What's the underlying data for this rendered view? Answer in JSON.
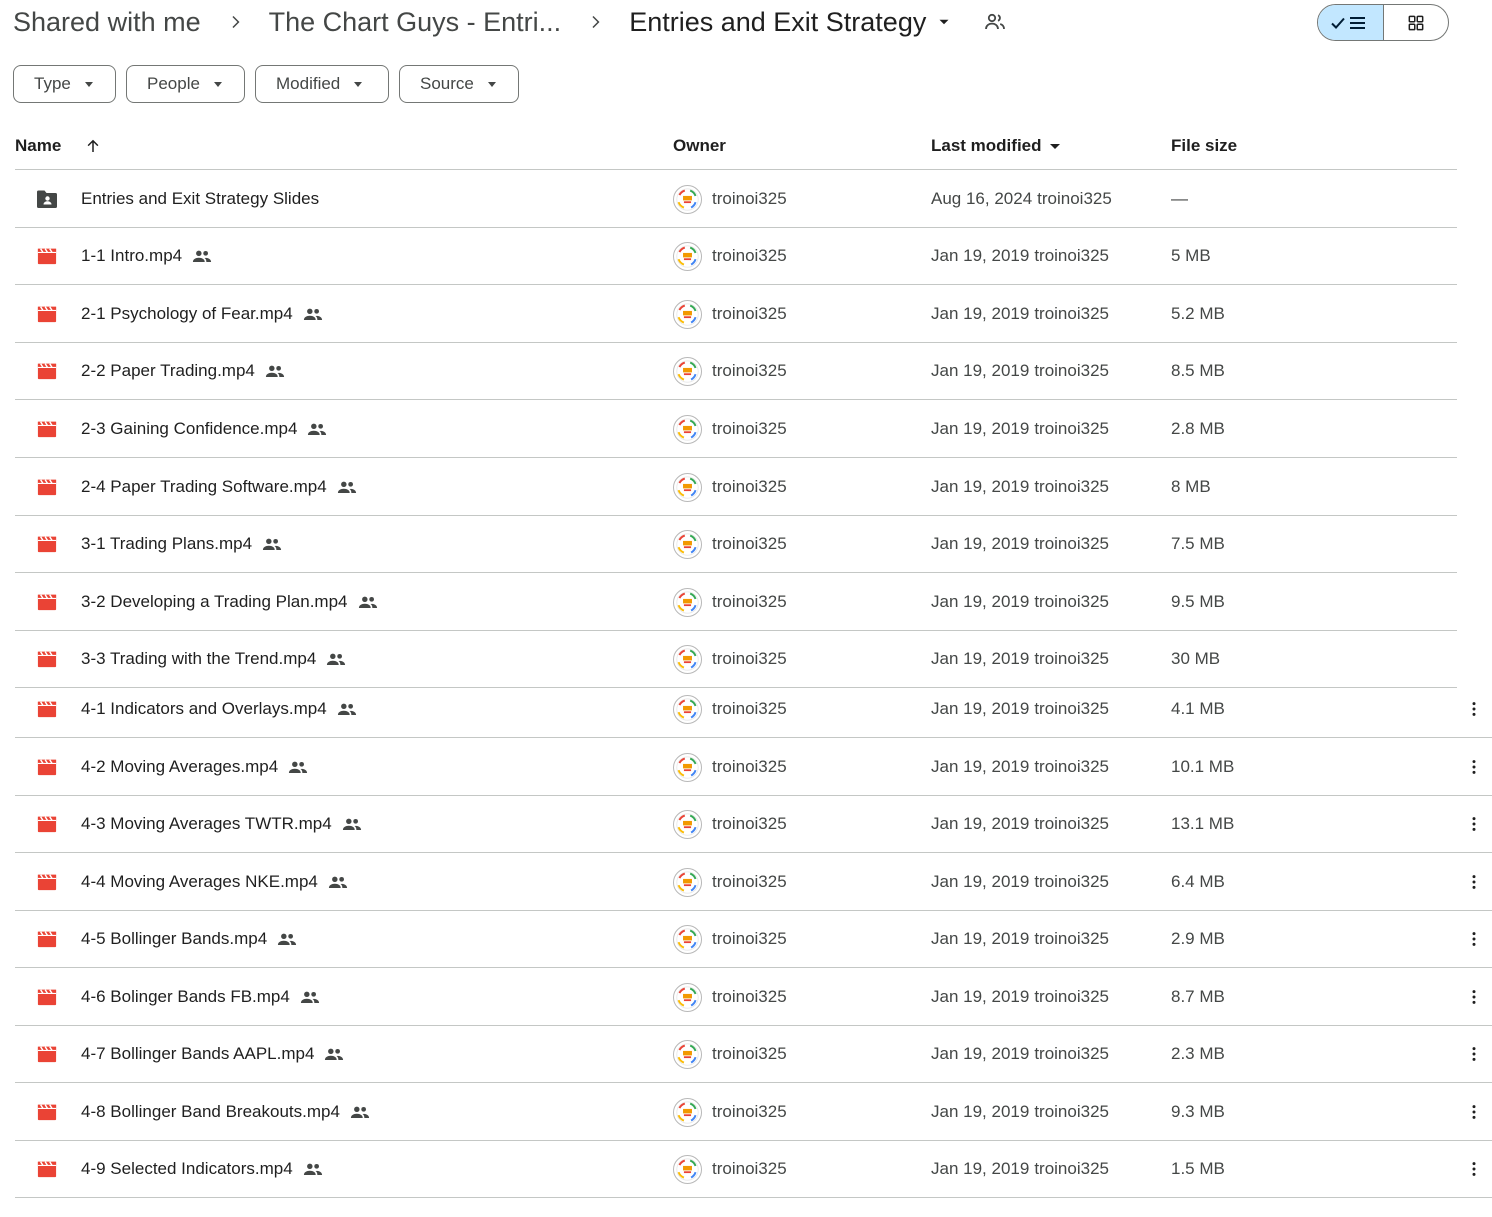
{
  "breadcrumb": {
    "root": "Shared with me",
    "parent": "The Chart Guys - Entri...",
    "current": "Entries and Exit Strategy"
  },
  "filters": [
    "Type",
    "People",
    "Modified",
    "Source"
  ],
  "columns": {
    "name": "Name",
    "owner": "Owner",
    "modified": "Last modified",
    "size": "File size"
  },
  "icons": {
    "folder": "shared-folder-icon",
    "video": "video-file-icon",
    "shared": "shared-people-icon",
    "more": "more-vert-icon"
  },
  "colors": {
    "accent": "#c2e7ff",
    "video_icon": "#ea4335",
    "folder_icon": "#444746"
  },
  "files": [
    {
      "type": "folder",
      "name": "Entries and Exit Strategy Slides",
      "shared": false,
      "owner": "troinoi325",
      "modified": "Aug 16, 2024",
      "modified_by": "troinoi325",
      "size": "—",
      "more": false
    },
    {
      "type": "video",
      "name": "1-1 Intro.mp4",
      "shared": true,
      "owner": "troinoi325",
      "modified": "Jan 19, 2019",
      "modified_by": "troinoi325",
      "size": "5 MB",
      "more": false
    },
    {
      "type": "video",
      "name": "2-1 Psychology of Fear.mp4",
      "shared": true,
      "owner": "troinoi325",
      "modified": "Jan 19, 2019",
      "modified_by": "troinoi325",
      "size": "5.2 MB",
      "more": false
    },
    {
      "type": "video",
      "name": "2-2 Paper Trading.mp4",
      "shared": true,
      "owner": "troinoi325",
      "modified": "Jan 19, 2019",
      "modified_by": "troinoi325",
      "size": "8.5 MB",
      "more": false
    },
    {
      "type": "video",
      "name": "2-3 Gaining Confidence.mp4",
      "shared": true,
      "owner": "troinoi325",
      "modified": "Jan 19, 2019",
      "modified_by": "troinoi325",
      "size": "2.8 MB",
      "more": false
    },
    {
      "type": "video",
      "name": "2-4 Paper Trading Software.mp4",
      "shared": true,
      "owner": "troinoi325",
      "modified": "Jan 19, 2019",
      "modified_by": "troinoi325",
      "size": "8 MB",
      "more": false
    },
    {
      "type": "video",
      "name": "3-1 Trading Plans.mp4",
      "shared": true,
      "owner": "troinoi325",
      "modified": "Jan 19, 2019",
      "modified_by": "troinoi325",
      "size": "7.5 MB",
      "more": false
    },
    {
      "type": "video",
      "name": "3-2 Developing a Trading Plan.mp4",
      "shared": true,
      "owner": "troinoi325",
      "modified": "Jan 19, 2019",
      "modified_by": "troinoi325",
      "size": "9.5 MB",
      "more": false
    },
    {
      "type": "video",
      "name": "3-3 Trading with the Trend.mp4",
      "shared": true,
      "owner": "troinoi325",
      "modified": "Jan 19, 2019",
      "modified_by": "troinoi325",
      "size": "30 MB",
      "more": false
    },
    {
      "type": "video",
      "name": "4-1 Indicators and Overlays.mp4",
      "shared": true,
      "owner": "troinoi325",
      "modified": "Jan 19, 2019",
      "modified_by": "troinoi325",
      "size": "4.1 MB",
      "more": true
    },
    {
      "type": "video",
      "name": "4-2 Moving Averages.mp4",
      "shared": true,
      "owner": "troinoi325",
      "modified": "Jan 19, 2019",
      "modified_by": "troinoi325",
      "size": "10.1 MB",
      "more": true
    },
    {
      "type": "video",
      "name": "4-3 Moving Averages TWTR.mp4",
      "shared": true,
      "owner": "troinoi325",
      "modified": "Jan 19, 2019",
      "modified_by": "troinoi325",
      "size": "13.1 MB",
      "more": true
    },
    {
      "type": "video",
      "name": "4-4 Moving Averages NKE.mp4",
      "shared": true,
      "owner": "troinoi325",
      "modified": "Jan 19, 2019",
      "modified_by": "troinoi325",
      "size": "6.4 MB",
      "more": true
    },
    {
      "type": "video",
      "name": "4-5 Bollinger Bands.mp4",
      "shared": true,
      "owner": "troinoi325",
      "modified": "Jan 19, 2019",
      "modified_by": "troinoi325",
      "size": "2.9 MB",
      "more": true
    },
    {
      "type": "video",
      "name": "4-6 Bolinger Bands FB.mp4",
      "shared": true,
      "owner": "troinoi325",
      "modified": "Jan 19, 2019",
      "modified_by": "troinoi325",
      "size": "8.7 MB",
      "more": true
    },
    {
      "type": "video",
      "name": "4-7 Bollinger Bands AAPL.mp4",
      "shared": true,
      "owner": "troinoi325",
      "modified": "Jan 19, 2019",
      "modified_by": "troinoi325",
      "size": "2.3 MB",
      "more": true
    },
    {
      "type": "video",
      "name": "4-8 Bollinger Band Breakouts.mp4",
      "shared": true,
      "owner": "troinoi325",
      "modified": "Jan 19, 2019",
      "modified_by": "troinoi325",
      "size": "9.3 MB",
      "more": true
    },
    {
      "type": "video",
      "name": "4-9 Selected Indicators.mp4",
      "shared": true,
      "owner": "troinoi325",
      "modified": "Jan 19, 2019",
      "modified_by": "troinoi325",
      "size": "1.5 MB",
      "more": true
    }
  ]
}
